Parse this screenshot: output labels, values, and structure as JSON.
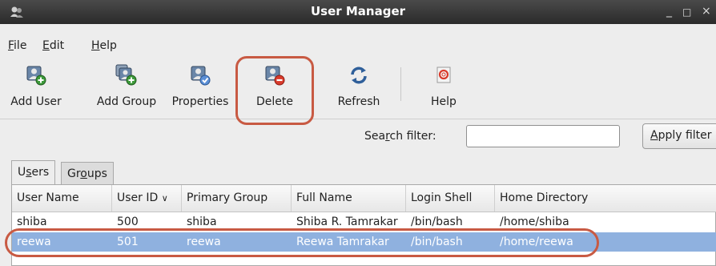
{
  "window": {
    "title": "User Manager",
    "controls": [
      "_",
      "□",
      "×"
    ]
  },
  "menu": [
    {
      "label": "File",
      "mnemonic": "F",
      "rest": "ile"
    },
    {
      "label": "Edit",
      "mnemonic": "E",
      "rest": "dit"
    },
    {
      "label": "Help",
      "mnemonic": "H",
      "rest": "elp"
    }
  ],
  "toolbar": {
    "add_user": "Add User",
    "add_group": "Add Group",
    "properties": "Properties",
    "delete": "Delete",
    "refresh": "Refresh",
    "help": "Help"
  },
  "search": {
    "label_pre": "Sea",
    "label_mnemonic": "r",
    "label_post": "ch filter:",
    "value": "",
    "apply_mnemonic": "A",
    "apply_rest": "pply filter"
  },
  "tabs": [
    {
      "pre": "U",
      "mnemonic": "s",
      "post": "ers",
      "active": true
    },
    {
      "pre": "Gr",
      "mnemonic": "o",
      "post": "ups",
      "active": false
    }
  ],
  "table": {
    "columns": [
      "User Name",
      "User ID",
      "Primary Group",
      "Full Name",
      "Login Shell",
      "Home Directory"
    ],
    "sort_indicator": "∨",
    "rows": [
      [
        "shiba",
        "500",
        "shiba",
        "Shiba R. Tamrakar",
        "/bin/bash",
        "/home/shiba"
      ],
      [
        "reewa",
        "501",
        "reewa",
        "Reewa Tamrakar",
        "/bin/bash",
        "/home/reewa"
      ]
    ],
    "selected_row": 1
  },
  "colors": {
    "annotation": "#c85a43",
    "selection": "#8fb1df",
    "titlebar": "#333333"
  }
}
